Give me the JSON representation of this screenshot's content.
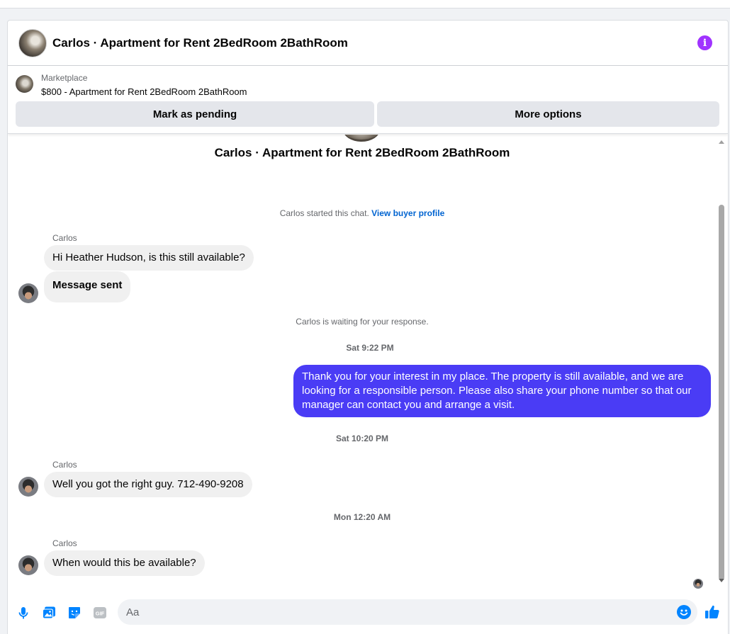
{
  "header": {
    "title": "Carlos · Apartment for Rent 2BedRoom 2BathRoom"
  },
  "listing": {
    "label": "Marketplace",
    "price_title": "$800 - Apartment for Rent 2BedRoom 2BathRoom",
    "mark_pending_label": "Mark as pending",
    "more_options_label": "More options"
  },
  "thread": {
    "title": "Carlos · Apartment for Rent 2BedRoom 2BathRoom",
    "started_text": "Carlos started this chat.",
    "view_profile_label": "View buyer profile",
    "waiting_text": "Carlos is waiting for your response.",
    "timestamps": [
      "Sat 9:22 PM",
      "Sat 10:20 PM",
      "Mon 12:20 AM"
    ],
    "sender_name": "Carlos",
    "messages": {
      "m1": "Hi Heather Hudson, is this still available?",
      "m2": "Message sent",
      "m3": "Thank you for your interest in my place. The property is still available, and we are looking for a responsible person. Please also share your phone number so that our manager can contact you and arrange a visit.",
      "m4": "Well you got the right guy. 712-490-9208",
      "m5": "When would this be available?"
    }
  },
  "composer": {
    "placeholder": "Aa"
  },
  "colors": {
    "outgoing_bubble": "#4a3cf5",
    "incoming_bubble": "#f0f0f0",
    "accent_blue": "#0084ff",
    "info_purple": "#a033ff",
    "link_blue": "#0064d1"
  },
  "icons": [
    "info-icon",
    "microphone-icon",
    "photo-icon",
    "sticker-icon",
    "gif-icon",
    "emoji-icon",
    "thumbs-up-icon"
  ]
}
